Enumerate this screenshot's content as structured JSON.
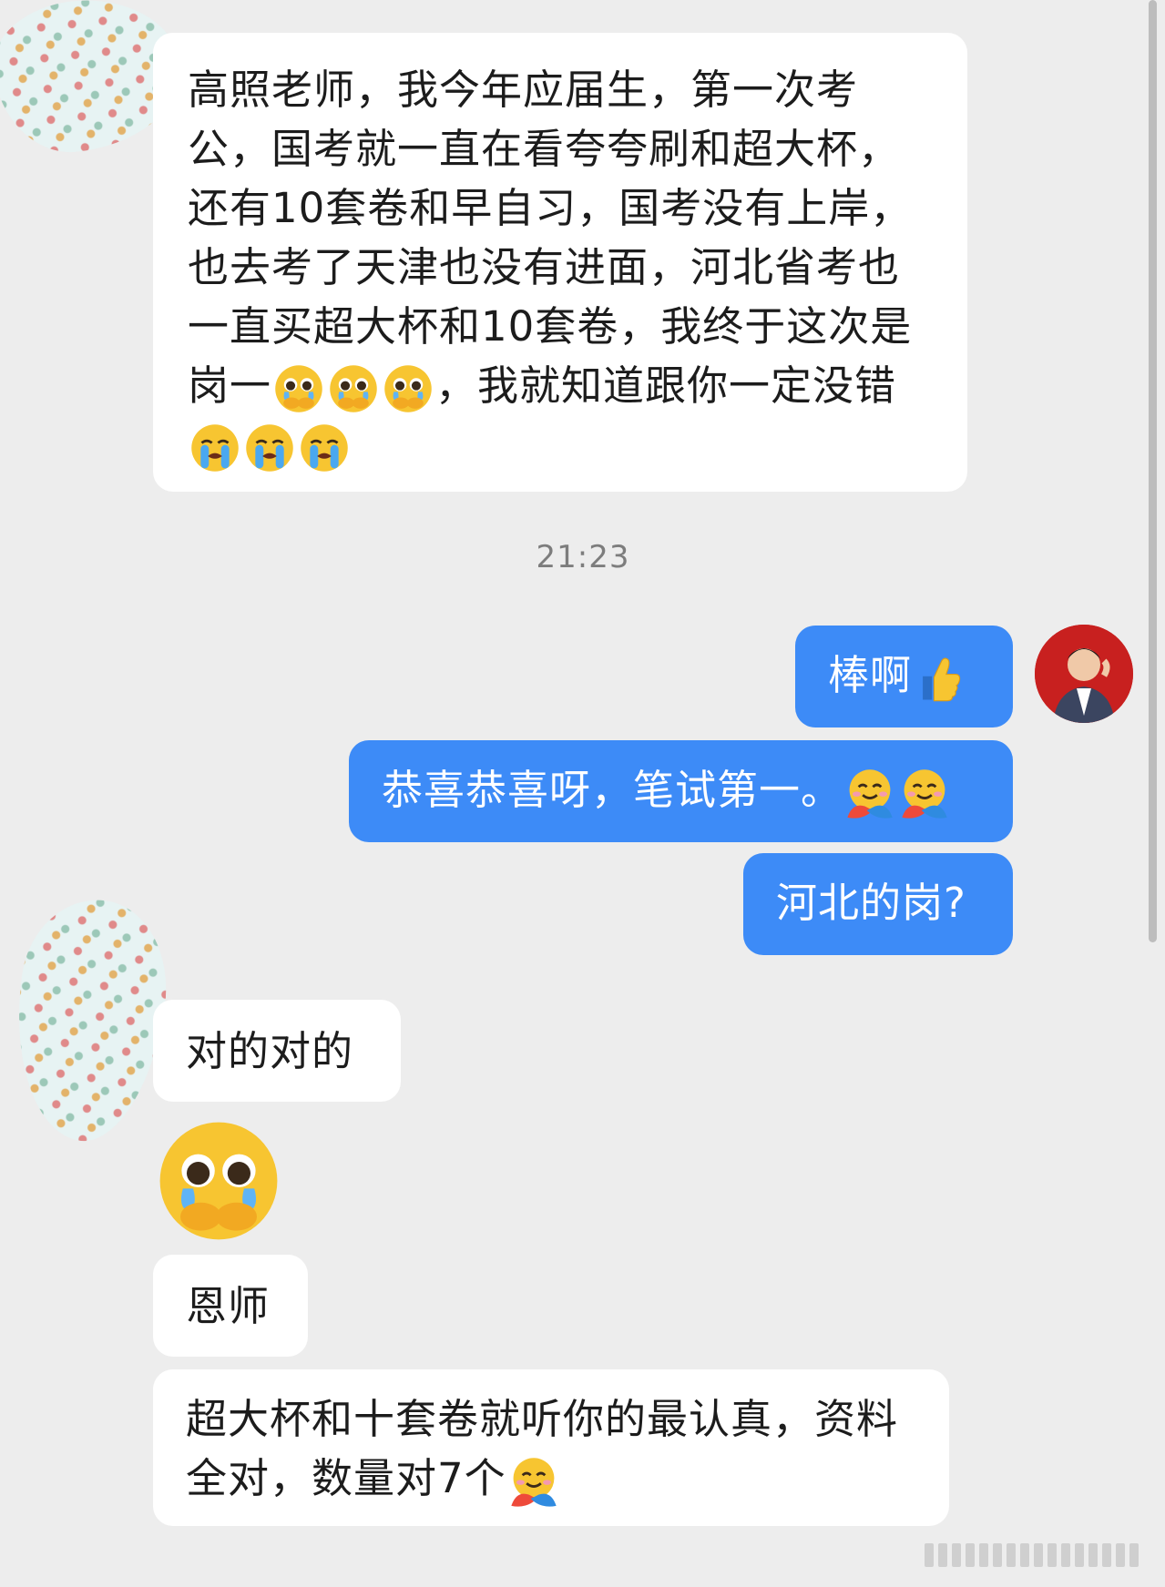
{
  "messages": {
    "msg1": "高照老师，我今年应届生，第一次考公，国考就一直在看夸夸刷和超大杯，还有10套卷和早自习，国考没有上岸，也去考了天津也没有进面，河北省考也一直买超大杯和10套卷，我终于这次是岗一",
    "msg1_mid": "，我就知道跟你一定没错",
    "timestamp": "21:23",
    "reply1": "棒啊",
    "reply2": "恭喜恭喜呀，笔试第一。",
    "reply3": "河北的岗?",
    "msg_yes": "对的对的",
    "msg_grace": "恩师",
    "msg_last": "超大杯和十套卷就听你的最认真，资料全对，数量对7个"
  },
  "icons": {
    "pleading": "pleading-face-emoji",
    "crying": "loudly-crying-face-emoji",
    "thumbs": "thumbs-up-emoji",
    "hug": "hugging-face-emoji"
  },
  "colors": {
    "background": "#ededed",
    "incoming_bubble": "#ffffff",
    "outgoing_bubble": "#3d8bf7",
    "timestamp": "#7d7d7d"
  }
}
